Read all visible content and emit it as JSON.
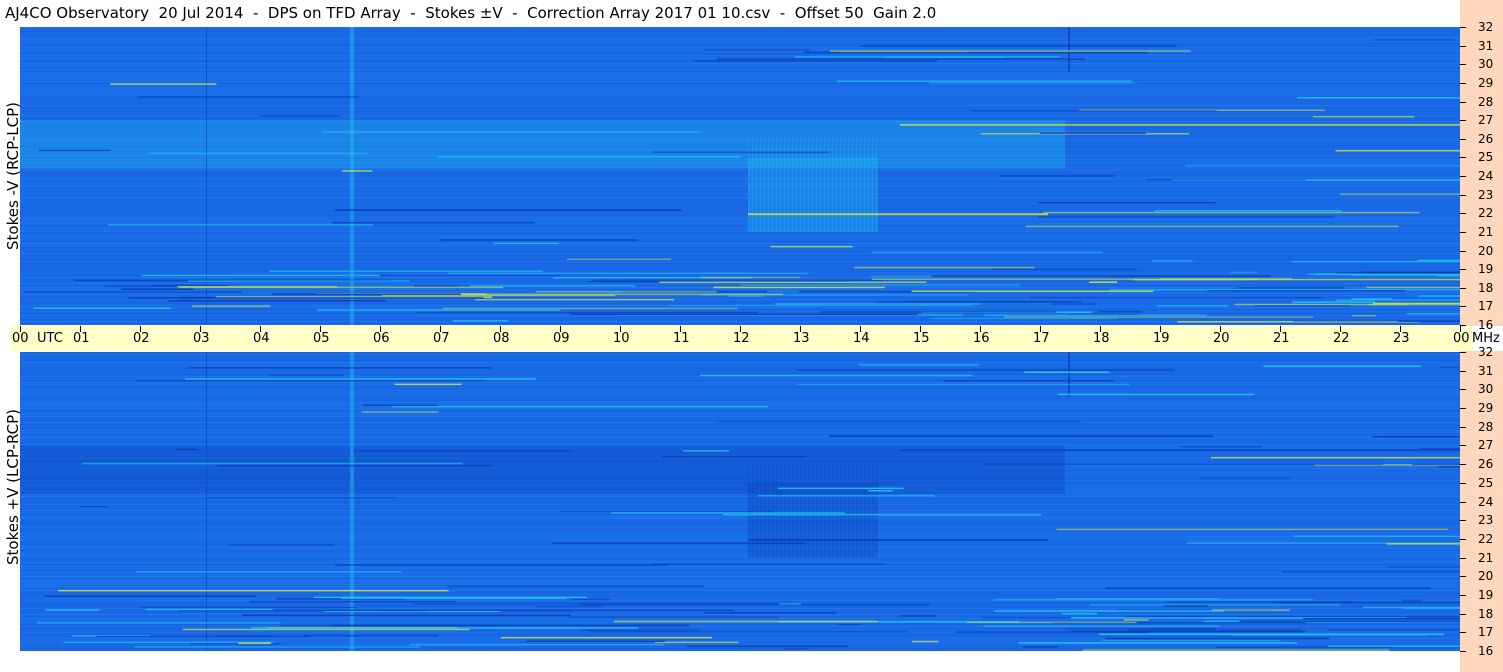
{
  "title": "AJ4CO Observatory  20 Jul 2014  -  DPS on TFD Array  -  Stokes ±V  -  Correction Array 2017 01 10.csv  -  Offset 50  Gain 2.0",
  "chart_data": [
    {
      "type": "heatmap",
      "title": "",
      "ylabel": "Stokes -V (RCP-LCP)",
      "xlabel": "",
      "x_ticks": [
        "00",
        "01",
        "02",
        "03",
        "04",
        "05",
        "06",
        "07",
        "08",
        "09",
        "10",
        "11",
        "12",
        "13",
        "14",
        "15",
        "16",
        "17",
        "18",
        "19",
        "20",
        "21",
        "22",
        "23",
        "00"
      ],
      "x_unit": "UTC",
      "xlim": [
        0,
        24
      ],
      "y_ticks": [
        "16",
        "17",
        "18",
        "19",
        "20",
        "21",
        "22",
        "23",
        "24",
        "25",
        "26",
        "27",
        "28",
        "29",
        "30",
        "31",
        "32"
      ],
      "y_unit": "MHz",
      "ylim": [
        16,
        32
      ]
    },
    {
      "type": "heatmap",
      "title": "",
      "ylabel": "Stokes +V (LCP-RCP)",
      "xlabel": "",
      "x_ticks": [
        "00",
        "01",
        "02",
        "03",
        "04",
        "05",
        "06",
        "07",
        "08",
        "09",
        "10",
        "11",
        "12",
        "13",
        "14",
        "15",
        "16",
        "17",
        "18",
        "19",
        "20",
        "21",
        "22",
        "23",
        "00"
      ],
      "x_unit": "UTC",
      "xlim": [
        0,
        24
      ],
      "y_ticks": [
        "16",
        "17",
        "18",
        "19",
        "20",
        "21",
        "22",
        "23",
        "24",
        "25",
        "26",
        "27",
        "28",
        "29",
        "30",
        "31",
        "32"
      ],
      "y_unit": "MHz",
      "ylim": [
        16,
        32
      ]
    }
  ],
  "colors": {
    "background_blue": "#1a6ae8",
    "dark_blue": "#0c3fb8",
    "bright_cyan": "#22c4ee",
    "yellow_green": "#c8e04a",
    "time_bar": "#ffffc8",
    "freq_scale": "#ffd7bc"
  }
}
